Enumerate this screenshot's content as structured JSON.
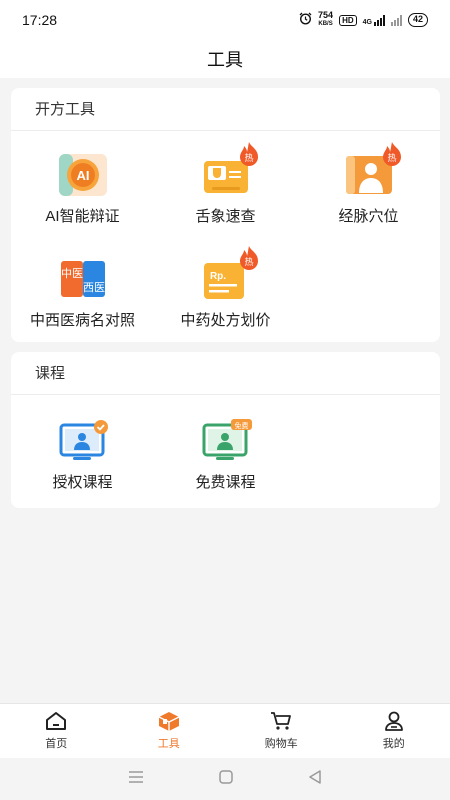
{
  "status_bar": {
    "time": "17:28",
    "net_speed_value": "754",
    "net_speed_unit": "KB/S",
    "hd_badge": "HD",
    "signal_label": "4G",
    "battery": "42"
  },
  "header": {
    "title": "工具"
  },
  "prescription_card": {
    "title": "开方工具",
    "tools": [
      {
        "label": "AI智能辩证",
        "hot": false,
        "icon": "ai-icon",
        "icon_text": "AI"
      },
      {
        "label": "舌象速查",
        "hot": true,
        "hot_text": "热",
        "icon": "tongue-icon"
      },
      {
        "label": "经脉穴位",
        "hot": true,
        "hot_text": "热",
        "icon": "meridian-icon"
      },
      {
        "label": "中西医病名对照",
        "hot": false,
        "icon": "cn-west-icon",
        "icon_text_left": "中医",
        "icon_text_right": "西医"
      },
      {
        "label": "中药处方划价",
        "hot": true,
        "hot_text": "热",
        "icon": "prescription-icon",
        "icon_text": "Rp."
      }
    ]
  },
  "course_card": {
    "title": "课程",
    "items": [
      {
        "label": "授权课程",
        "icon": "authorized-course-icon"
      },
      {
        "label": "免费课程",
        "icon": "free-course-icon",
        "badge": "免费"
      }
    ]
  },
  "tabbar": {
    "items": [
      {
        "label": "首页",
        "icon": "home-icon",
        "active": false
      },
      {
        "label": "工具",
        "icon": "toolbox-icon",
        "active": true
      },
      {
        "label": "购物车",
        "icon": "cart-icon",
        "active": false
      },
      {
        "label": "我的",
        "icon": "user-icon",
        "active": false
      }
    ]
  },
  "colors": {
    "accent": "#f07a2c",
    "hot": "#f05a28",
    "blue": "#2a86e0",
    "green": "#3aa36a"
  }
}
